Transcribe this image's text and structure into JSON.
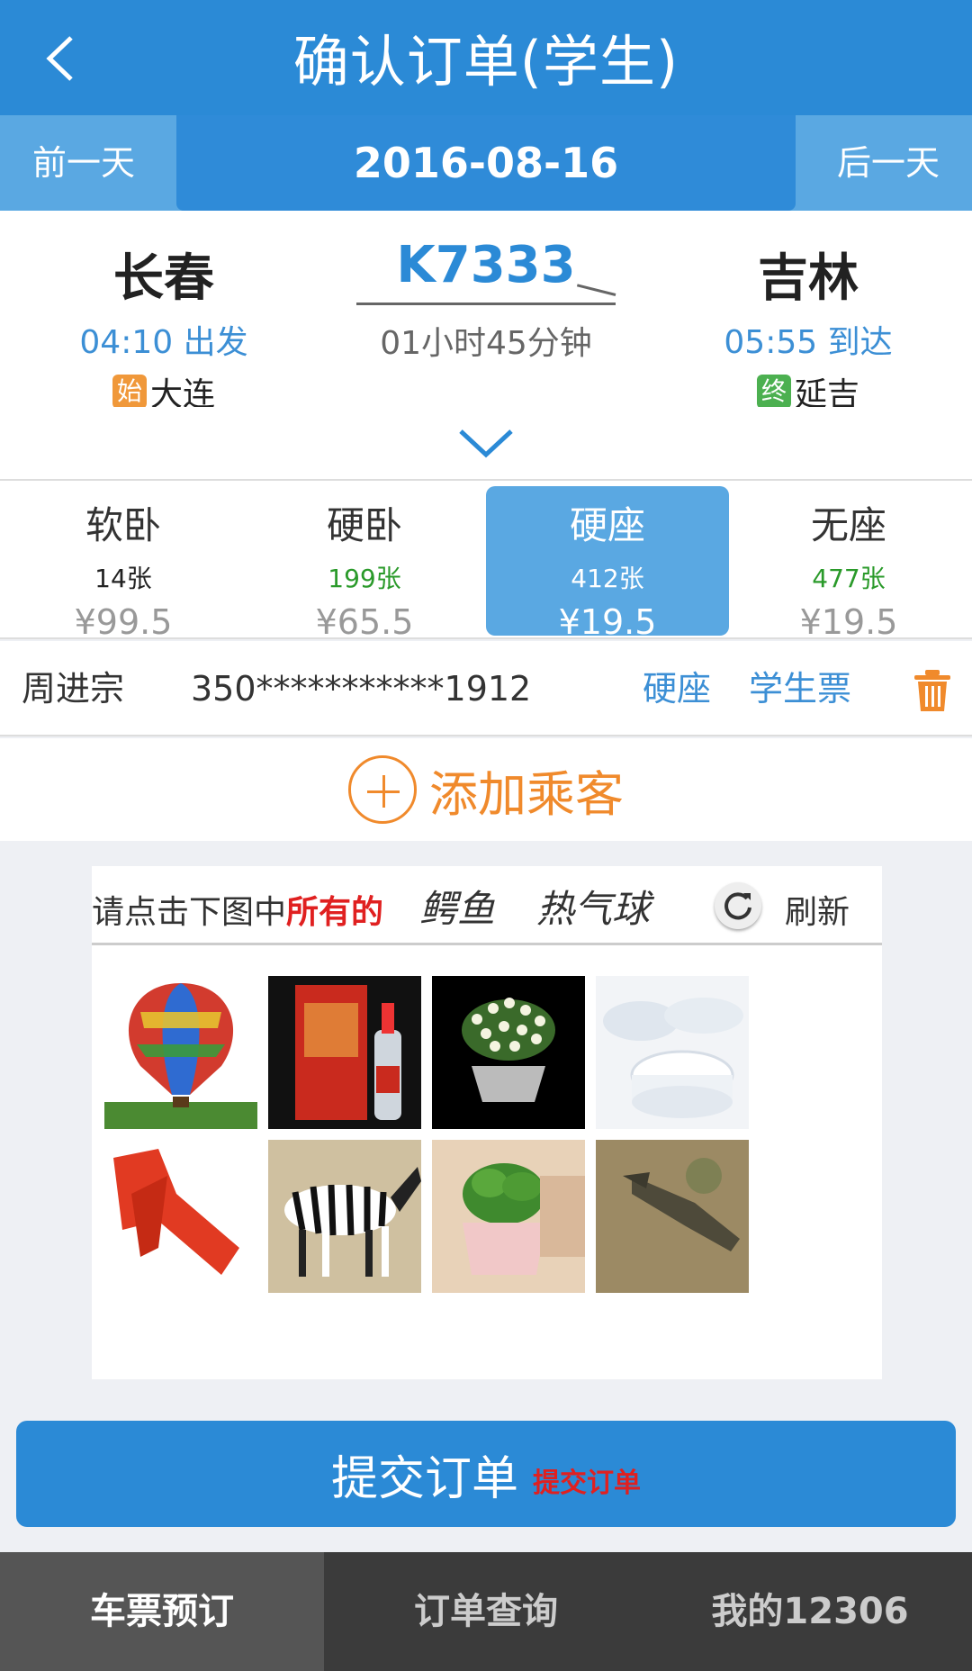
{
  "header": {
    "title": "确认订单(学生)"
  },
  "datebar": {
    "prev_label": "前一天",
    "date": "2016-08-16",
    "next_label": "后一天"
  },
  "train": {
    "from": {
      "station": "长春",
      "time": "04:10 出发",
      "tag": "始",
      "terminal": "大连"
    },
    "number": "K7333",
    "duration": "01小时45分钟",
    "to": {
      "station": "吉林",
      "time": "05:55 到达",
      "tag": "终",
      "terminal": "延吉"
    }
  },
  "seats": [
    {
      "name": "软卧",
      "count": "14张",
      "price": "¥99.5",
      "count_color": "#222222"
    },
    {
      "name": "硬卧",
      "count": "199张",
      "price": "¥65.5",
      "count_color": "#2a9a2a"
    },
    {
      "name": "硬座",
      "count": "412张",
      "price": "¥19.5",
      "count_color": "#ffffff"
    },
    {
      "name": "无座",
      "count": "477张",
      "price": "¥19.5",
      "count_color": "#2a9a2a"
    }
  ],
  "passenger": {
    "name": "周进宗",
    "id": "350***********1912",
    "seat": "硬座",
    "ticket_type": "学生票"
  },
  "add_passenger": {
    "label": "添加乘客"
  },
  "captcha": {
    "prompt_prefix": "请点击下图中",
    "prompt_highlight": "所有的",
    "keywords": [
      "鳄鱼",
      "热气球"
    ],
    "refresh_label": "刷新",
    "tiles": [
      "hot-air-balloon",
      "liquor-bottle-box",
      "flower-pot",
      "white-discs",
      "red-scarf",
      "zebra",
      "potted-plant",
      "crocodile"
    ]
  },
  "submit": {
    "label": "提交订单",
    "sub_label": "提交订单"
  },
  "tabbar": [
    {
      "label": "车票预订",
      "active": true
    },
    {
      "label": "订单查询",
      "active": false
    },
    {
      "label": "我的12306",
      "active": false
    }
  ],
  "colors": {
    "primary": "#2b8ad6",
    "light": "#5aa8e2",
    "accent": "#f08a2c",
    "warning": "#e02020"
  }
}
